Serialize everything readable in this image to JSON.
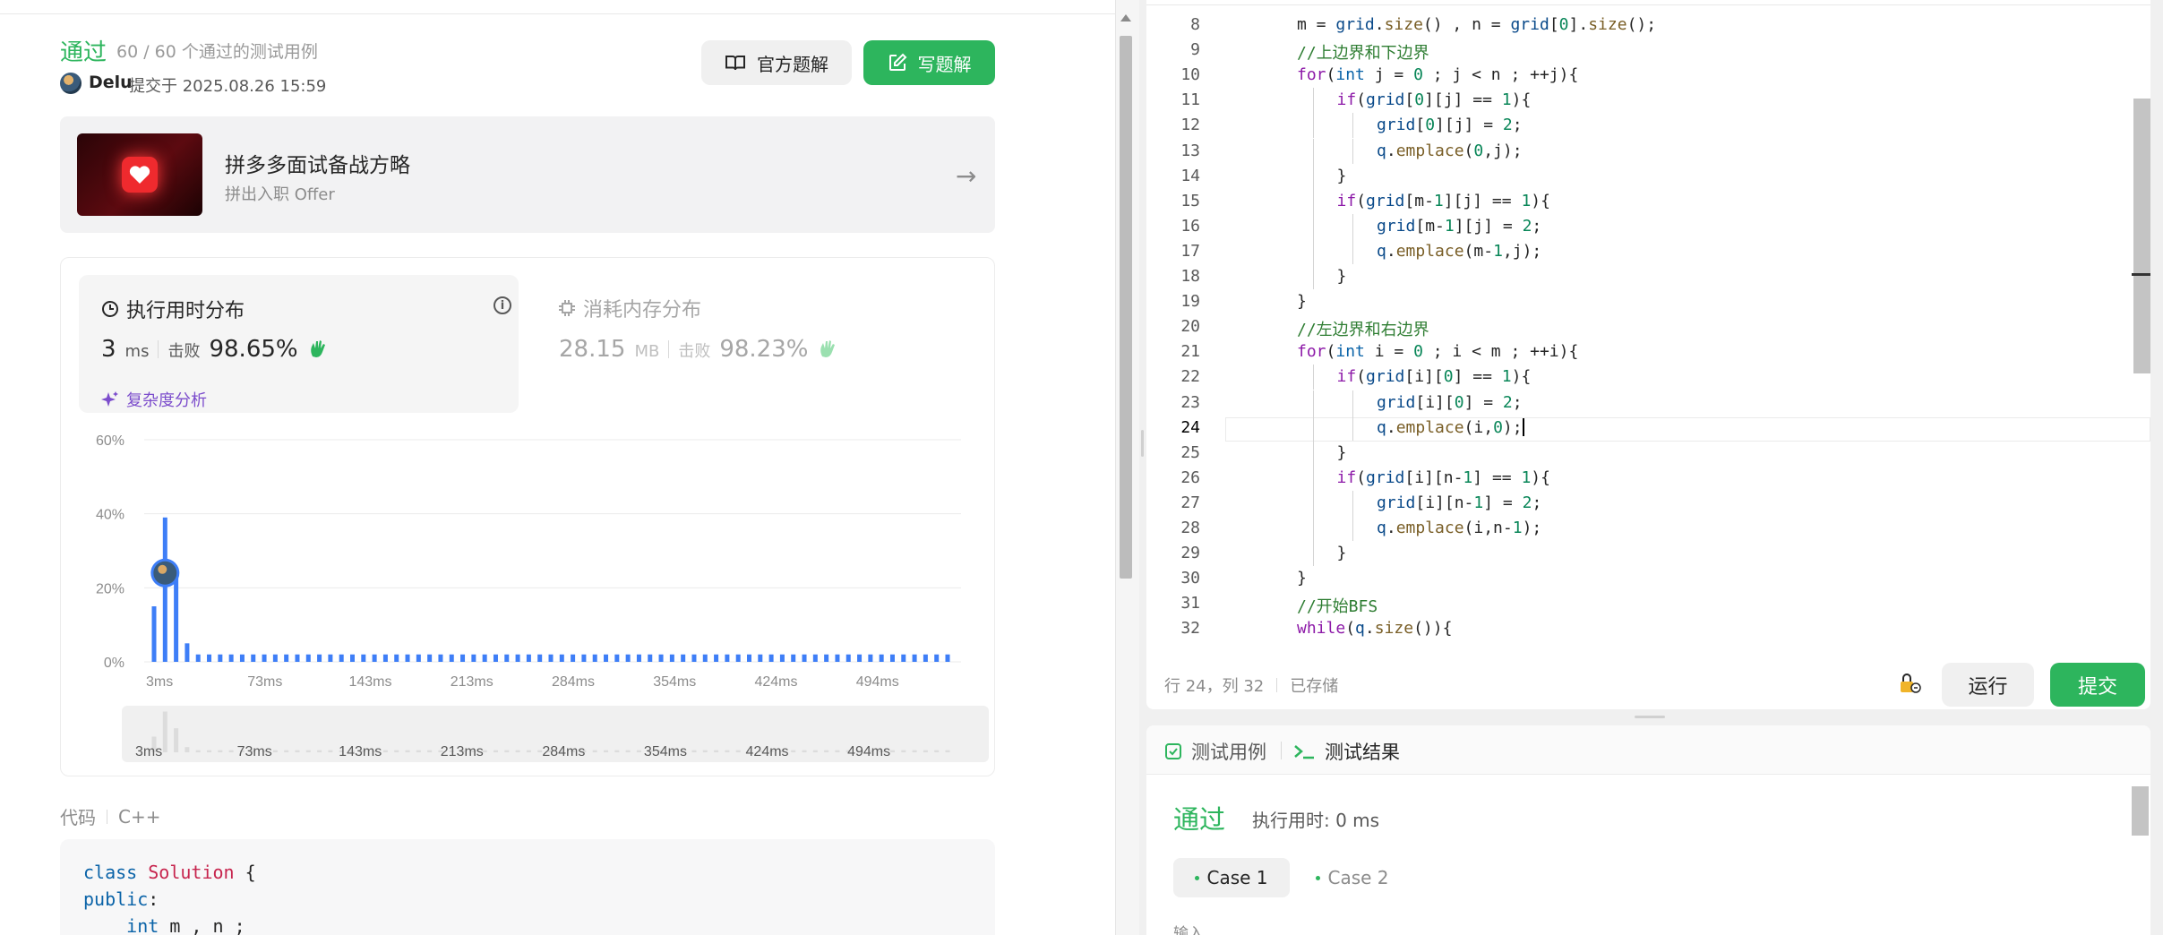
{
  "submission": {
    "status": "通过",
    "testcase_summary": "60 / 60 个通过的测试用例",
    "user": "Delu",
    "submitted_at": "提交于 2025.08.26 15:59",
    "official_solution_label": "官方题解",
    "write_solution_label": "写题解"
  },
  "promo": {
    "title": "拼多多面试备战方略",
    "subtitle": "拼出入职 Offer"
  },
  "stats": {
    "runtime_title": "执行用时分布",
    "runtime_value": "3",
    "runtime_unit": "ms",
    "beat_label": "击败",
    "runtime_beat": "98.65%",
    "complexity_label": "复杂度分析",
    "memory_title": "消耗内存分布",
    "memory_value": "28.15",
    "memory_unit": "MB",
    "memory_beat": "98.23%"
  },
  "chart_data": {
    "type": "bar",
    "yticks": [
      "60%",
      "40%",
      "20%",
      "0%"
    ],
    "ylim": [
      0,
      60
    ],
    "xticks": [
      "3ms",
      "73ms",
      "143ms",
      "213ms",
      "284ms",
      "354ms",
      "424ms",
      "494ms"
    ],
    "values": [
      15,
      39,
      23,
      5,
      2,
      2,
      2,
      2,
      2,
      2,
      2,
      2,
      2,
      2,
      2,
      2,
      2,
      2,
      2,
      2,
      2,
      2,
      2,
      2,
      2,
      2,
      2,
      2,
      2,
      2,
      2,
      2,
      2,
      2,
      2,
      2,
      2,
      2,
      2,
      2,
      2,
      2,
      2,
      2,
      2,
      2,
      2,
      2,
      2,
      2,
      2,
      2,
      2,
      2,
      2,
      2,
      2,
      2,
      2,
      2,
      2,
      2,
      2,
      2,
      2,
      2,
      2,
      2,
      2,
      2,
      2,
      2,
      2
    ],
    "user_marker_index": 1,
    "user_marker_value": 24,
    "bar_color": "#3e7ef7"
  },
  "code_section": {
    "label": "代码",
    "language": "C++",
    "lines": [
      [
        {
          "t": "class",
          "c": "kw-blue"
        },
        {
          "t": " "
        },
        {
          "t": "Solution",
          "c": "kw-red"
        },
        {
          "t": " {"
        }
      ],
      [
        {
          "t": "public",
          "c": "kw-blue"
        },
        {
          "t": ":"
        }
      ],
      [
        {
          "t": "    "
        },
        {
          "t": "int",
          "c": "kw-blue"
        },
        {
          "t": " m , n ;"
        }
      ]
    ]
  },
  "editor": {
    "lines": [
      {
        "no": "8",
        "indent": 1,
        "tokens": [
          {
            "t": "m = "
          },
          {
            "t": "grid",
            "c": "t-var"
          },
          {
            "t": "."
          },
          {
            "t": "size",
            "c": "t-fn"
          },
          {
            "t": "() , n = "
          },
          {
            "t": "grid",
            "c": "t-var"
          },
          {
            "t": "["
          },
          {
            "t": "0",
            "c": "t-num"
          },
          {
            "t": "]."
          },
          {
            "t": "size",
            "c": "t-fn"
          },
          {
            "t": "();"
          }
        ]
      },
      {
        "no": "9",
        "indent": 1,
        "tokens": [
          {
            "t": "//上边界和下边界",
            "c": "t-cm"
          }
        ]
      },
      {
        "no": "10",
        "indent": 1,
        "tokens": [
          {
            "t": "for",
            "c": "t-kw"
          },
          {
            "t": "("
          },
          {
            "t": "int",
            "c": "t-type"
          },
          {
            "t": " j = "
          },
          {
            "t": "0",
            "c": "t-num"
          },
          {
            "t": " ; j < n ; ++j){"
          }
        ]
      },
      {
        "no": "11",
        "indent": 2,
        "tokens": [
          {
            "t": "if",
            "c": "t-kw"
          },
          {
            "t": "("
          },
          {
            "t": "grid",
            "c": "t-var"
          },
          {
            "t": "["
          },
          {
            "t": "0",
            "c": "t-num"
          },
          {
            "t": "][j] == "
          },
          {
            "t": "1",
            "c": "t-num"
          },
          {
            "t": "){"
          }
        ]
      },
      {
        "no": "12",
        "indent": 3,
        "tokens": [
          {
            "t": "grid",
            "c": "t-var"
          },
          {
            "t": "["
          },
          {
            "t": "0",
            "c": "t-num"
          },
          {
            "t": "][j] = "
          },
          {
            "t": "2",
            "c": "t-num"
          },
          {
            "t": ";"
          }
        ]
      },
      {
        "no": "13",
        "indent": 3,
        "tokens": [
          {
            "t": "q",
            "c": "t-var"
          },
          {
            "t": "."
          },
          {
            "t": "emplace",
            "c": "t-fn"
          },
          {
            "t": "("
          },
          {
            "t": "0",
            "c": "t-num"
          },
          {
            "t": ",j);"
          }
        ]
      },
      {
        "no": "14",
        "indent": 2,
        "tokens": [
          {
            "t": "}"
          }
        ]
      },
      {
        "no": "15",
        "indent": 2,
        "tokens": [
          {
            "t": "if",
            "c": "t-kw"
          },
          {
            "t": "("
          },
          {
            "t": "grid",
            "c": "t-var"
          },
          {
            "t": "[m-"
          },
          {
            "t": "1",
            "c": "t-num"
          },
          {
            "t": "][j] == "
          },
          {
            "t": "1",
            "c": "t-num"
          },
          {
            "t": "){"
          }
        ]
      },
      {
        "no": "16",
        "indent": 3,
        "tokens": [
          {
            "t": "grid",
            "c": "t-var"
          },
          {
            "t": "[m-"
          },
          {
            "t": "1",
            "c": "t-num"
          },
          {
            "t": "][j] = "
          },
          {
            "t": "2",
            "c": "t-num"
          },
          {
            "t": ";"
          }
        ]
      },
      {
        "no": "17",
        "indent": 3,
        "tokens": [
          {
            "t": "q",
            "c": "t-var"
          },
          {
            "t": "."
          },
          {
            "t": "emplace",
            "c": "t-fn"
          },
          {
            "t": "(m-"
          },
          {
            "t": "1",
            "c": "t-num"
          },
          {
            "t": ",j);"
          }
        ]
      },
      {
        "no": "18",
        "indent": 2,
        "tokens": [
          {
            "t": "}"
          }
        ]
      },
      {
        "no": "19",
        "indent": 1,
        "tokens": [
          {
            "t": "}"
          }
        ]
      },
      {
        "no": "20",
        "indent": 1,
        "tokens": [
          {
            "t": "//左边界和右边界",
            "c": "t-cm"
          }
        ]
      },
      {
        "no": "21",
        "indent": 1,
        "tokens": [
          {
            "t": "for",
            "c": "t-kw"
          },
          {
            "t": "("
          },
          {
            "t": "int",
            "c": "t-type"
          },
          {
            "t": " i = "
          },
          {
            "t": "0",
            "c": "t-num"
          },
          {
            "t": " ; i < m ; ++i){"
          }
        ]
      },
      {
        "no": "22",
        "indent": 2,
        "tokens": [
          {
            "t": "if",
            "c": "t-kw"
          },
          {
            "t": "("
          },
          {
            "t": "grid",
            "c": "t-var"
          },
          {
            "t": "[i]["
          },
          {
            "t": "0",
            "c": "t-num"
          },
          {
            "t": "] == "
          },
          {
            "t": "1",
            "c": "t-num"
          },
          {
            "t": "){"
          }
        ]
      },
      {
        "no": "23",
        "indent": 3,
        "tokens": [
          {
            "t": "grid",
            "c": "t-var"
          },
          {
            "t": "[i]["
          },
          {
            "t": "0",
            "c": "t-num"
          },
          {
            "t": "] = "
          },
          {
            "t": "2",
            "c": "t-num"
          },
          {
            "t": ";"
          }
        ]
      },
      {
        "no": "24",
        "indent": 3,
        "current": true,
        "tokens": [
          {
            "t": "q",
            "c": "t-var"
          },
          {
            "t": "."
          },
          {
            "t": "emplace",
            "c": "t-fn"
          },
          {
            "t": "(i,"
          },
          {
            "t": "0",
            "c": "t-num"
          },
          {
            "t": ");"
          }
        ]
      },
      {
        "no": "25",
        "indent": 2,
        "tokens": [
          {
            "t": "}"
          }
        ]
      },
      {
        "no": "26",
        "indent": 2,
        "tokens": [
          {
            "t": "if",
            "c": "t-kw"
          },
          {
            "t": "("
          },
          {
            "t": "grid",
            "c": "t-var"
          },
          {
            "t": "[i][n-"
          },
          {
            "t": "1",
            "c": "t-num"
          },
          {
            "t": "] == "
          },
          {
            "t": "1",
            "c": "t-num"
          },
          {
            "t": "){"
          }
        ]
      },
      {
        "no": "27",
        "indent": 3,
        "tokens": [
          {
            "t": "grid",
            "c": "t-var"
          },
          {
            "t": "[i][n-"
          },
          {
            "t": "1",
            "c": "t-num"
          },
          {
            "t": "] = "
          },
          {
            "t": "2",
            "c": "t-num"
          },
          {
            "t": ";"
          }
        ]
      },
      {
        "no": "28",
        "indent": 3,
        "tokens": [
          {
            "t": "q",
            "c": "t-var"
          },
          {
            "t": "."
          },
          {
            "t": "emplace",
            "c": "t-fn"
          },
          {
            "t": "(i,n-"
          },
          {
            "t": "1",
            "c": "t-num"
          },
          {
            "t": ");"
          }
        ]
      },
      {
        "no": "29",
        "indent": 2,
        "tokens": [
          {
            "t": "}"
          }
        ]
      },
      {
        "no": "30",
        "indent": 1,
        "tokens": [
          {
            "t": "}"
          }
        ]
      },
      {
        "no": "31",
        "indent": 1,
        "tokens": [
          {
            "t": "//开始BFS",
            "c": "t-cm"
          }
        ]
      },
      {
        "no": "32",
        "indent": 1,
        "tokens": [
          {
            "t": "while",
            "c": "t-kw"
          },
          {
            "t": "("
          },
          {
            "t": "q",
            "c": "t-var"
          },
          {
            "t": "."
          },
          {
            "t": "size",
            "c": "t-fn"
          },
          {
            "t": "()){"
          }
        ]
      }
    ],
    "status_position": "行 24，列 32",
    "status_saved": "已存储",
    "run_label": "运行",
    "submit_label": "提交"
  },
  "result_panel": {
    "tab_cases": "测试用例",
    "tab_results": "测试结果",
    "status": "通过",
    "runtime": "执行用时: 0 ms",
    "case1": "Case 1",
    "case2": "Case 2",
    "input_label": "输入"
  },
  "colors": {
    "accent_green": "#2db55d",
    "bar_blue": "#3e7ef7",
    "complexity_purple": "#7c4dcc"
  }
}
